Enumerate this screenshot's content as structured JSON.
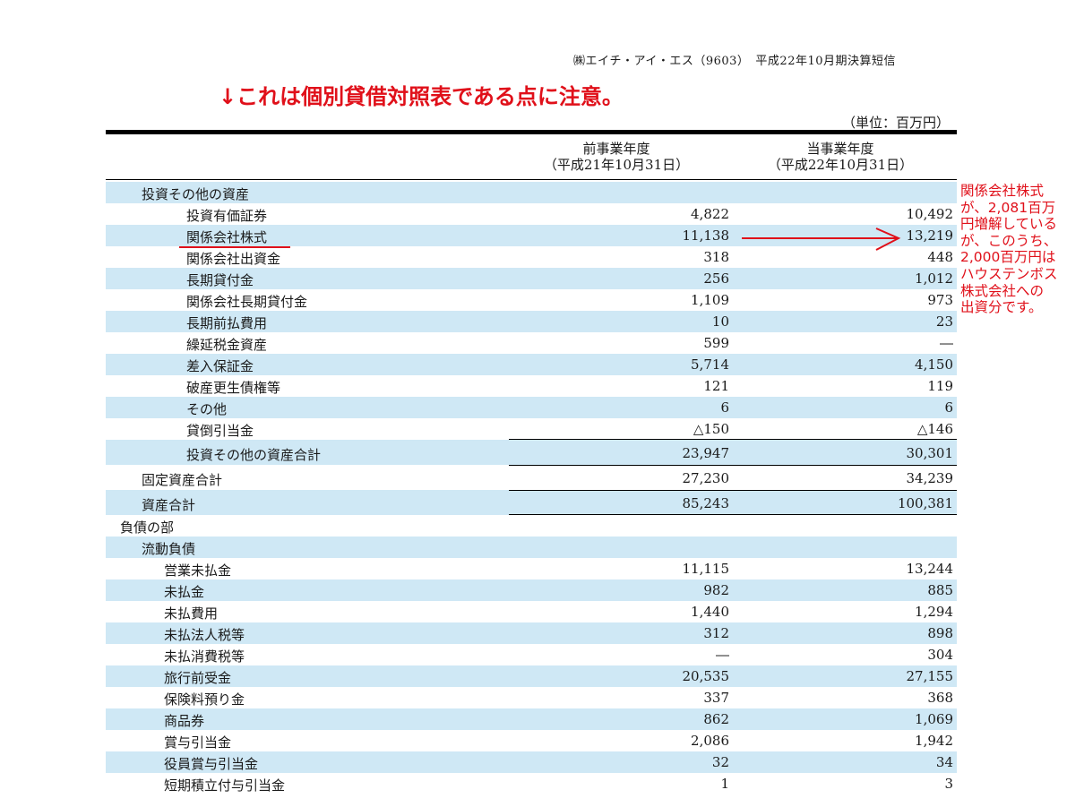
{
  "header": {
    "company_line": "㈱エイチ・アイ・エス（9603）　平成22年10月期決算短信",
    "note": "↓これは個別貸借対照表である点に注意。",
    "unit": "（単位：百万円）"
  },
  "columns": {
    "prev_title": "前事業年度",
    "prev_date": "（平成21年10月31日）",
    "curr_title": "当事業年度",
    "curr_date": "（平成22年10月31日）"
  },
  "rows": [
    {
      "label": "投資その他の資産",
      "prev": "",
      "curr": ""
    },
    {
      "label": "投資有価証券",
      "prev": "4,822",
      "curr": "10,492"
    },
    {
      "label": "関係会社株式",
      "prev": "11,138",
      "curr": "13,219"
    },
    {
      "label": "関係会社出資金",
      "prev": "318",
      "curr": "448"
    },
    {
      "label": "長期貸付金",
      "prev": "256",
      "curr": "1,012"
    },
    {
      "label": "関係会社長期貸付金",
      "prev": "1,109",
      "curr": "973"
    },
    {
      "label": "長期前払費用",
      "prev": "10",
      "curr": "23"
    },
    {
      "label": "繰延税金資産",
      "prev": "599",
      "curr": "―"
    },
    {
      "label": "差入保証金",
      "prev": "5,714",
      "curr": "4,150"
    },
    {
      "label": "破産更生債権等",
      "prev": "121",
      "curr": "119"
    },
    {
      "label": "その他",
      "prev": "6",
      "curr": "6"
    },
    {
      "label": "貸倒引当金",
      "prev": "△150",
      "curr": "△146"
    },
    {
      "label": "投資その他の資産合計",
      "prev": "23,947",
      "curr": "30,301"
    },
    {
      "label": "固定資産合計",
      "prev": "27,230",
      "curr": "34,239"
    },
    {
      "label": "資産合計",
      "prev": "85,243",
      "curr": "100,381"
    },
    {
      "label": "負債の部",
      "prev": "",
      "curr": ""
    },
    {
      "label": "流動負債",
      "prev": "",
      "curr": ""
    },
    {
      "label": "営業未払金",
      "prev": "11,115",
      "curr": "13,244"
    },
    {
      "label": "未払金",
      "prev": "982",
      "curr": "885"
    },
    {
      "label": "未払費用",
      "prev": "1,440",
      "curr": "1,294"
    },
    {
      "label": "未払法人税等",
      "prev": "312",
      "curr": "898"
    },
    {
      "label": "未払消費税等",
      "prev": "―",
      "curr": "304"
    },
    {
      "label": "旅行前受金",
      "prev": "20,535",
      "curr": "27,155"
    },
    {
      "label": "保険料預り金",
      "prev": "337",
      "curr": "368"
    },
    {
      "label": "商品券",
      "prev": "862",
      "curr": "1,069"
    },
    {
      "label": "賞与引当金",
      "prev": "2,086",
      "curr": "1,942"
    },
    {
      "label": "役員賞与引当金",
      "prev": "32",
      "curr": "34"
    },
    {
      "label": "短期積立付与引当金",
      "prev": "1",
      "curr": "3"
    }
  ],
  "annotation": {
    "callout_lines": [
      "関係会社株式",
      "が、2,081百万",
      "円増解している",
      "が、このうち、",
      "2,000百万円は",
      "ハウステンボス",
      "株式会社への",
      "出資分です。"
    ],
    "color": "#e0101a"
  },
  "colors": {
    "row_shade": "#cfe8f5",
    "accent_red": "#e0101a"
  }
}
